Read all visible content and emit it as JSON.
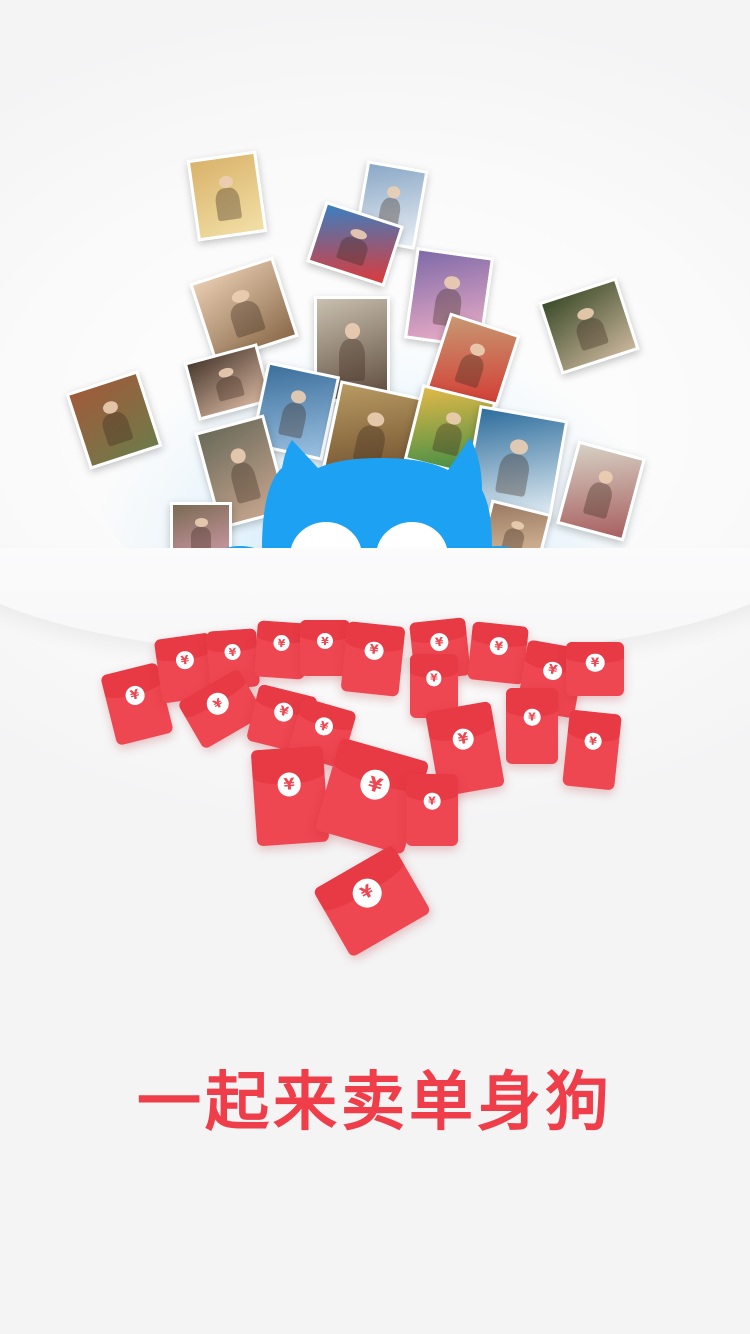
{
  "screen": {
    "type": "splash",
    "headline": "一起来卖单身狗"
  },
  "mascot": {
    "name": "blue-cat-mascot",
    "color": "#1da1f2"
  },
  "red_envelope": {
    "symbol": "¥",
    "color": "#ef4752",
    "count": 20
  },
  "photos": {
    "count": 24
  },
  "colors": {
    "background": "#f7f7f8",
    "headline": "#ef3e4a",
    "envelope": "#ef4752",
    "mascot": "#1da1f2"
  }
}
